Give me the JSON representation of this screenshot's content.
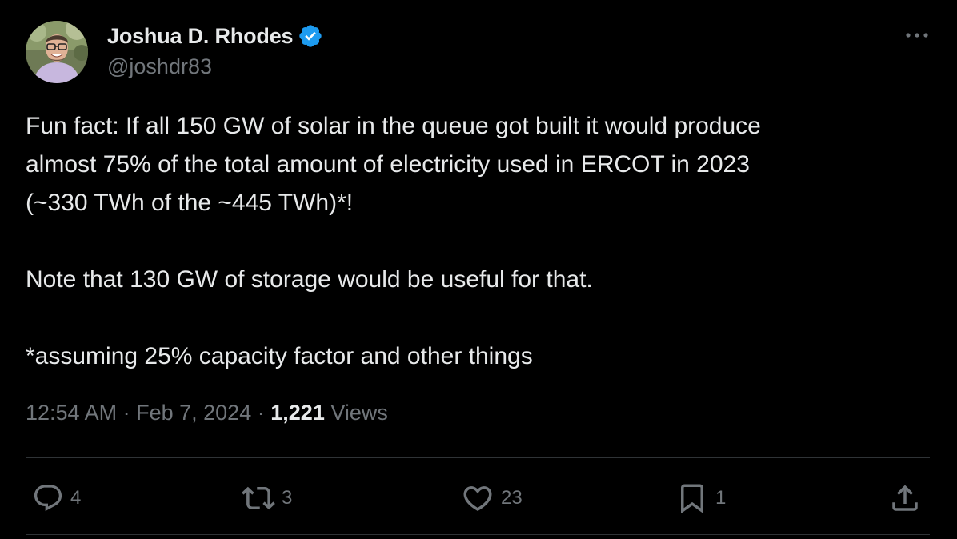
{
  "author": {
    "display_name": "Joshua D. Rhodes",
    "handle": "@joshdr83",
    "verified": true
  },
  "tweet": {
    "paragraphs": [
      [
        "Fun fact: If all 150 GW of solar in the queue got built it would produce",
        "almost 75% of the total amount of electricity used in ERCOT in 2023",
        "(~330 TWh of the ~445 TWh)*!"
      ],
      [
        "Note that 130 GW of storage would be useful for that."
      ],
      [
        "*assuming 25% capacity factor and other things"
      ]
    ]
  },
  "meta": {
    "time": "12:54 AM",
    "separator": "·",
    "date": "Feb 7, 2024",
    "views_count": "1,221",
    "views_label": "Views"
  },
  "actions": {
    "replies": "4",
    "reposts": "3",
    "likes": "23",
    "bookmarks": "1"
  },
  "icons": {
    "more": "more-dots-icon",
    "verified": "verified-badge-icon",
    "reply": "reply-bubble-icon",
    "repost": "repost-arrows-icon",
    "like": "heart-icon",
    "bookmark": "bookmark-icon",
    "share": "share-upload-icon"
  },
  "colors": {
    "background": "#000000",
    "text_primary": "#e7e9ea",
    "text_secondary": "#71767b",
    "verified_blue": "#1d9bf0",
    "divider": "#2f3336"
  }
}
